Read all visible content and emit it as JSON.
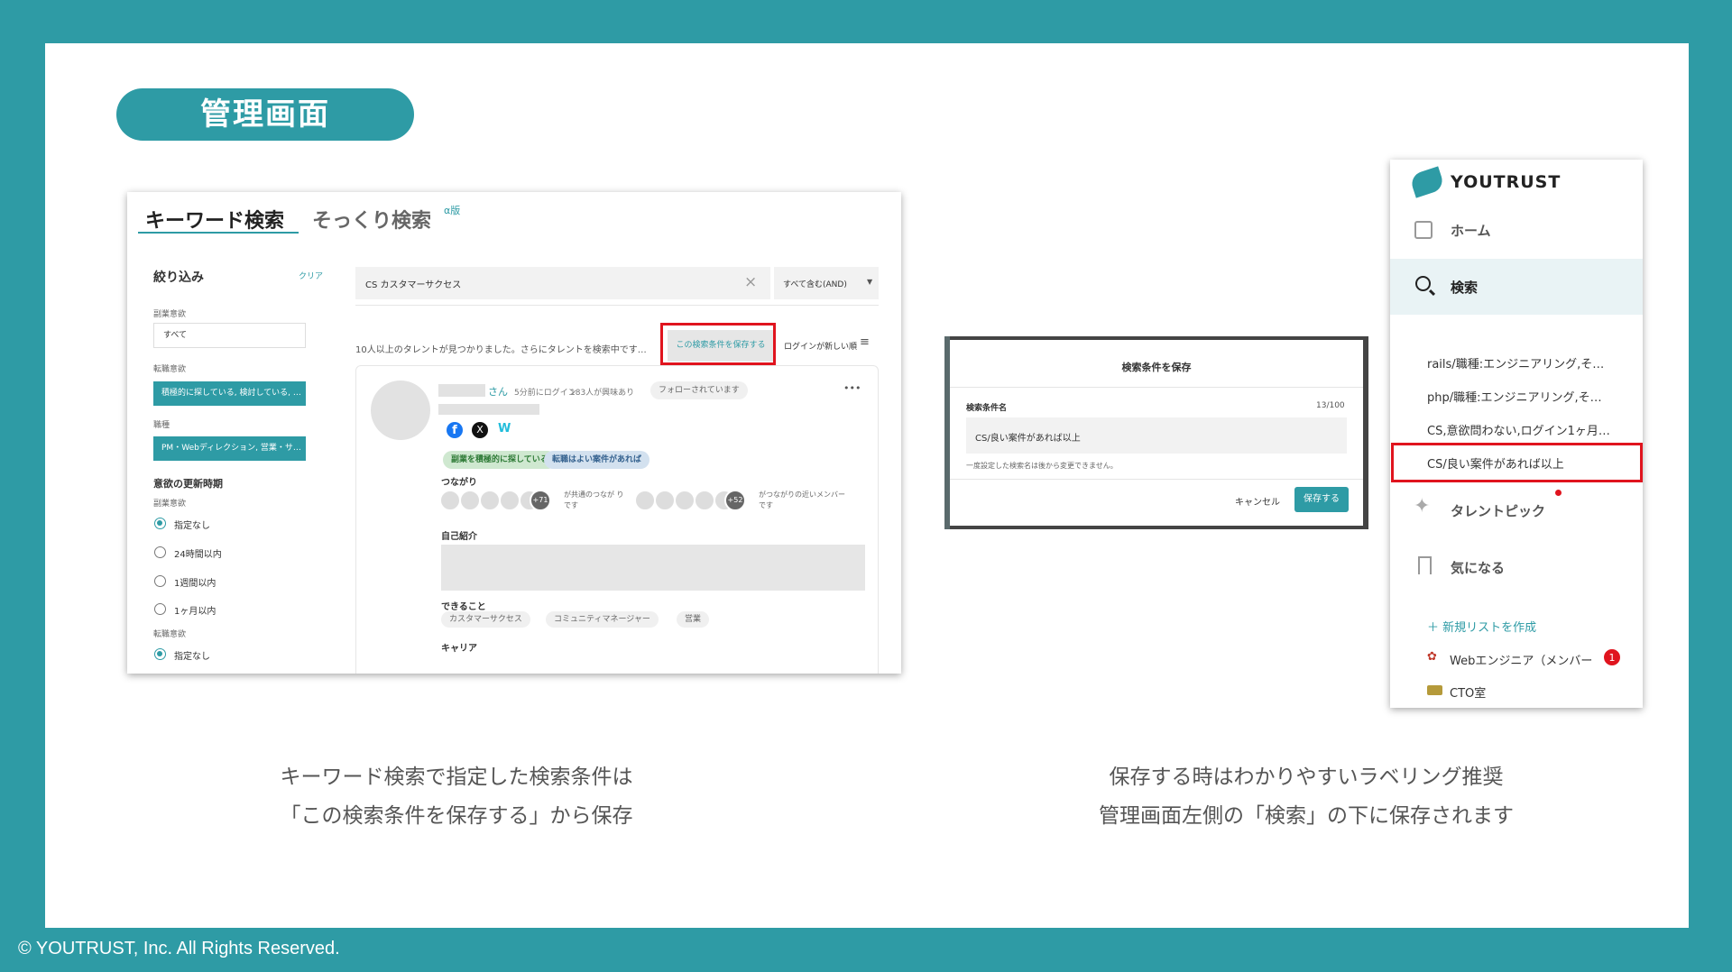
{
  "slide_title": "管理画面",
  "footer": "© YOUTRUST, Inc. All Rights Reserved.",
  "search_screen": {
    "tab_keyword": "キーワード検索",
    "tab_similar": "そっくり検索",
    "alpha_badge": "α版",
    "filter_title": "絞り込み",
    "clear_link": "クリア",
    "label_side_job": "副業意欲",
    "side_job_value": "すべて",
    "label_job_change": "転職意欲",
    "job_change_value": "積極的に探している, 検討している, …",
    "label_job_type": "職種",
    "job_type_value": "PM・Webディレクション, 営業・サ…",
    "update_section": "意欲の更新時期",
    "label_side_job_2": "副業意欲",
    "radio_options": [
      "指定なし",
      "24時間以内",
      "1週間以内",
      "1ヶ月以内"
    ],
    "label_job_change_2": "転職意欲",
    "radio_option_last": "指定なし",
    "search_value": "CS カスタマーサクセス",
    "match_mode": "すべて含む(AND)",
    "result_text": "10人以上のタレントが見つかりました。さらにタレントを検索中です…",
    "save_condition_button": "この検索条件を保存する",
    "sort_label": "ログインが新しい順",
    "card": {
      "name_suffix": "さん",
      "login_info": "5分前にログイン",
      "interest_info": "183人が興味あり",
      "follow_badge": "フォローされています",
      "more": "•••",
      "tag_side_job": "副業を積極的に探している",
      "tag_job_change": "転職はよい案件があれば",
      "connections_label": "つながり",
      "conn_count_1": "+71",
      "conn_text_1": "が共通のつなが りです",
      "conn_count_2": "+52",
      "conn_text_2": "がつながりの近いメンバーです",
      "intro_label": "自己紹介",
      "skills_label": "できること",
      "skills": [
        "カスタマーサクセス",
        "コミュニティマネージャー",
        "営業"
      ],
      "career_label": "キャリア"
    }
  },
  "modal": {
    "title": "検索条件を保存",
    "field_label": "検索条件名",
    "counter": "13/100",
    "value": "CS/良い案件があれば以上",
    "note": "一度設定した検索名は後から変更できません。",
    "cancel": "キャンセル",
    "save": "保存する"
  },
  "sidebar": {
    "brand": "YOUTRUST",
    "home": "ホーム",
    "search": "検索",
    "saved_searches": [
      "rails/職種:エンジニアリング,そ…",
      "php/職種:エンジニアリング,そ…",
      "CS,意欲問わない,ログイン1ヶ月…",
      "CS/良い案件があれば以上"
    ],
    "talent_pick": "タレントピック",
    "bookmark": "気になる",
    "new_list": "＋ 新規リストを作成",
    "list_1": "Webエンジニア（メンバー",
    "list_1_badge": "1",
    "list_2": "CTO室"
  },
  "caption_left": [
    "キーワード検索で指定した検索条件は",
    "「この検索条件を保存する」から保存"
  ],
  "caption_right": [
    "保存する時はわかりやすいラベリング推奨",
    "管理画面左側の「検索」の下に保存されます"
  ],
  "colors": {
    "brand_teal": "#2e9ba5",
    "highlight_red": "#e0141e"
  }
}
